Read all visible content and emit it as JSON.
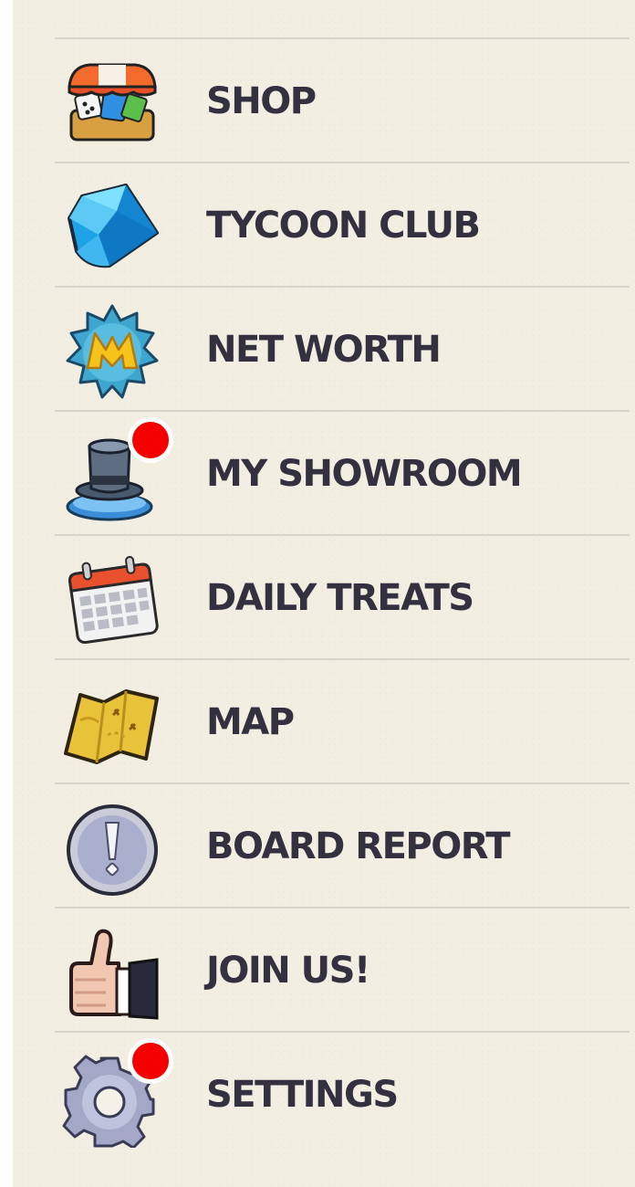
{
  "menu": {
    "items": [
      {
        "label": "SHOP",
        "icon": "shop-icon",
        "badge": false
      },
      {
        "label": "TYCOON CLUB",
        "icon": "diamond-icon",
        "badge": false
      },
      {
        "label": "NET WORTH",
        "icon": "net-worth-icon",
        "badge": false
      },
      {
        "label": "MY SHOWROOM",
        "icon": "top-hat-icon",
        "badge": true
      },
      {
        "label": "DAILY TREATS",
        "icon": "calendar-icon",
        "badge": false
      },
      {
        "label": "MAP",
        "icon": "map-icon",
        "badge": false
      },
      {
        "label": "BOARD REPORT",
        "icon": "alert-icon",
        "badge": false
      },
      {
        "label": "JOIN US!",
        "icon": "thumbs-up-icon",
        "badge": false
      },
      {
        "label": "SETTINGS",
        "icon": "gear-icon",
        "badge": true
      }
    ]
  },
  "colors": {
    "background": "#f2eee2",
    "text": "#33303f",
    "divider": "#d8d4cb",
    "badge": "#f40000"
  }
}
